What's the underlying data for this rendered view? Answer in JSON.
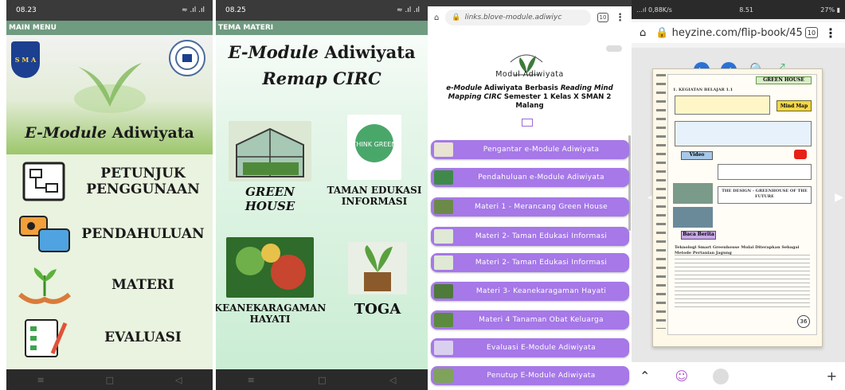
{
  "panel1": {
    "status_time": "08.23",
    "status_icons": "≈ .ıl .ıl",
    "appbar_title": "MAIN MENU",
    "shield_text": "S M A",
    "header_title_italic": "E-Module",
    "header_title_rest": " Adiwiyata",
    "menu": [
      {
        "label": "PETUNJUK PENGGUNAAN"
      },
      {
        "label": "PENDAHULUAN"
      },
      {
        "label": "MATERI"
      },
      {
        "label": "EVALUASI"
      }
    ],
    "nav": [
      "≡",
      "□",
      "◁"
    ]
  },
  "panel2": {
    "status_time": "08.25",
    "status_icons": "≈ .ıl .ıl",
    "appbar_title": "TEMA MATERI",
    "title_line1_italic": "E-Module",
    "title_line1_rest": " Adiwiyata",
    "title_line2": "Remap CIRC",
    "thumb_text": "THINK GREEN",
    "cards": [
      {
        "label": "GREEN HOUSE"
      },
      {
        "label": "TAMAN EDUKASI INFORMASI"
      },
      {
        "label": "KEANEKARAGAMAN HAYATI"
      },
      {
        "label": "TOGA"
      }
    ],
    "nav": [
      "≡",
      "□",
      "◁"
    ]
  },
  "panel3": {
    "url": "links.blove-module.adiwiyс",
    "tab_count": "10",
    "module_title": "Modul Adiwiyata",
    "subtitle_part1_italic": "e-Module",
    "subtitle_part2": " Adiwiyata Berbasis ",
    "subtitle_part3_italic": "Reading Mind Mapping CIRC",
    "subtitle_part4": " Semester 1 Kelas X SMAN 2 Malang",
    "buttons": [
      {
        "label": "Pengantar e-Module Adiwiyata"
      },
      {
        "label": "Pendahuluan e-Module Adiwiyata"
      },
      {
        "label": "Materi 1 - Merancang Green House"
      },
      {
        "label": "Materi 2- Taman Edukasi Informasi"
      },
      {
        "label": "Materi 2- Taman Edukasi Informasi"
      },
      {
        "label": "Materi 3- Keanekaragaman Hayati"
      },
      {
        "label": "Materi 4 Tanaman Obat Keluarga"
      },
      {
        "label": "Evaluasi E-Module Adiwiyata"
      },
      {
        "label": "Penutup E-Module Adiwiyata"
      }
    ]
  },
  "panel4": {
    "status_left": "…ıl 0,88K/s",
    "status_time": "8.51",
    "status_right": "27% ▮",
    "url": "heyzine.com/flip-book/45",
    "tab_count": "10",
    "page_header": "GREEN HOUSE",
    "section1": "1. KEGIATAN BELAJAR 1.1",
    "mind_map": "Mind Map",
    "section_video": "Video",
    "design_caption": "THE DESIGN - GREENHOUSE OF THE FUTURE",
    "section_news": "Baca Berita",
    "news_headline": "Teknologi Smart Greenhouse Mulai Diterapkan Sebagai Metode Pertanian Jagung",
    "page_number": "36"
  }
}
